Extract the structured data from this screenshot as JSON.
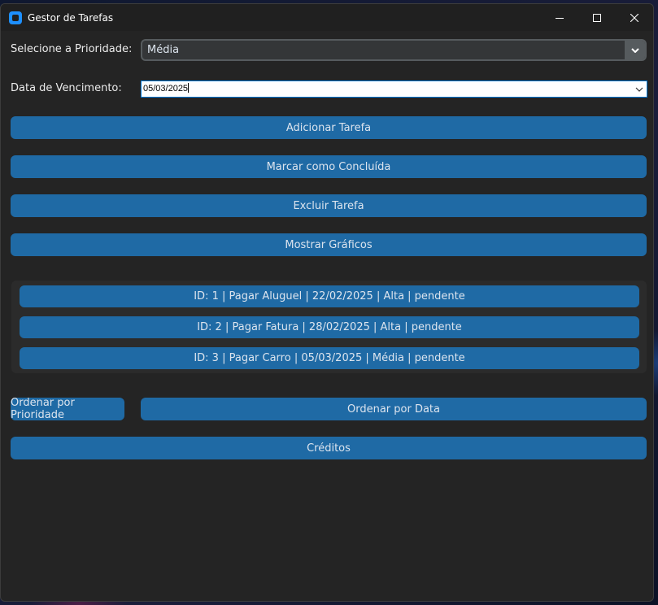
{
  "window": {
    "title": "Gestor de Tarefas",
    "accent": "#1f6aa5"
  },
  "form": {
    "priority_label": "Selecione a Prioridade:",
    "priority_value": "Média",
    "date_label": "Data de Vencimento:",
    "date_value": "05/03/2025"
  },
  "actions": {
    "add": "Adicionar Tarefa",
    "complete": "Marcar como Concluída",
    "delete": "Excluir Tarefa",
    "charts": "Mostrar Gráficos"
  },
  "tasks": [
    {
      "text": "ID: 1 | Pagar Aluguel | 22/02/2025 | Alta | pendente"
    },
    {
      "text": "ID: 2 | Pagar Fatura | 28/02/2025 | Alta | pendente"
    },
    {
      "text": "ID: 3 | Pagar Carro | 05/03/2025 | Média | pendente"
    }
  ],
  "sort": {
    "by_priority": "Ordenar por Prioridade",
    "by_date": "Ordenar por Data"
  },
  "credits": "Créditos"
}
